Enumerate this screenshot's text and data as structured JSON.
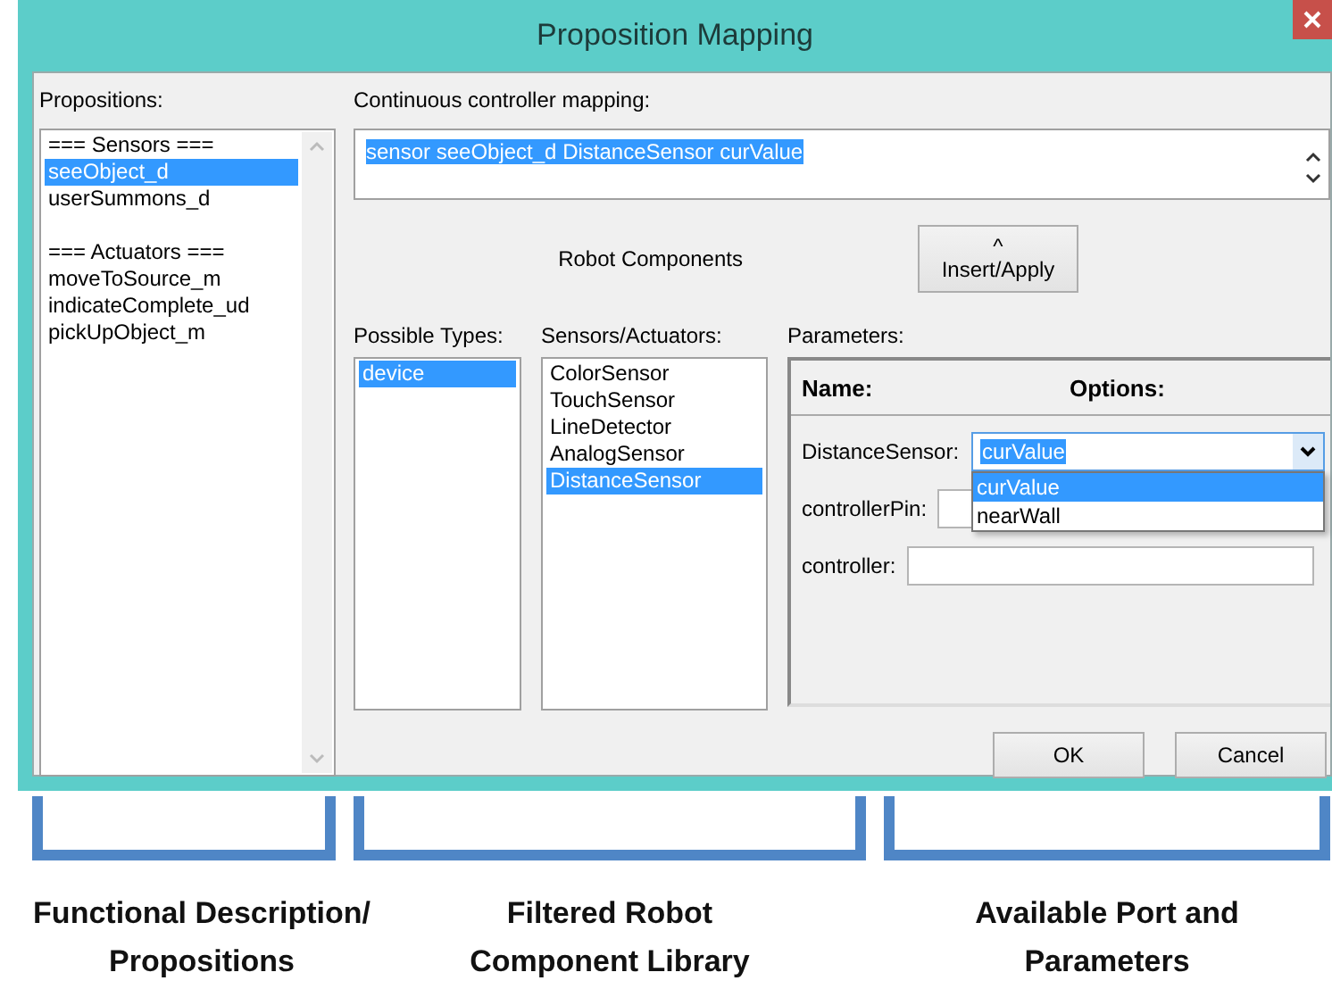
{
  "window": {
    "title": "Proposition Mapping"
  },
  "propositions": {
    "label": "Propositions:",
    "items": [
      {
        "text": "=== Sensors ===",
        "kind": "header",
        "selected": false
      },
      {
        "text": "seeObject_d",
        "kind": "item",
        "selected": true
      },
      {
        "text": "userSummons_d",
        "kind": "item",
        "selected": false
      },
      {
        "text": "=== Actuators ===",
        "kind": "header",
        "selected": false
      },
      {
        "text": "moveToSource_m",
        "kind": "item",
        "selected": false
      },
      {
        "text": "indicateComplete_ud",
        "kind": "item",
        "selected": false
      },
      {
        "text": "pickUpObject_m",
        "kind": "item",
        "selected": false
      }
    ]
  },
  "mapping": {
    "label": "Continuous controller mapping:",
    "value": "sensor seeObject_d DistanceSensor curValue",
    "selected": true
  },
  "robot_components": {
    "title": "Robot Components"
  },
  "insert_button": {
    "arrow": "^",
    "label": "Insert/Apply"
  },
  "possible_types": {
    "label": "Possible Types:",
    "items": [
      {
        "text": "device",
        "selected": true
      }
    ]
  },
  "sensors_actuators": {
    "label": "Sensors/Actuators:",
    "items": [
      {
        "text": "ColorSensor",
        "selected": false
      },
      {
        "text": "TouchSensor",
        "selected": false
      },
      {
        "text": "LineDetector",
        "selected": false
      },
      {
        "text": "AnalogSensor",
        "selected": false
      },
      {
        "text": "DistanceSensor",
        "selected": true
      }
    ]
  },
  "parameters": {
    "label": "Parameters:",
    "columns": [
      "Name:",
      "Options:"
    ],
    "rows": [
      {
        "name": "DistanceSensor:",
        "kind": "combo",
        "value": "curValue",
        "expanded": true,
        "options": [
          {
            "text": "curValue",
            "selected": true
          },
          {
            "text": "nearWall",
            "selected": false
          }
        ]
      },
      {
        "name": "controllerPin:",
        "kind": "text"
      },
      {
        "name": "controller:",
        "kind": "text"
      }
    ]
  },
  "buttons": [
    "OK",
    "Cancel"
  ],
  "annotations": [
    {
      "label": "Functional Description/\nPropositions"
    },
    {
      "label": "Filtered Robot\nComponent Library"
    },
    {
      "label": "Available Port and\nParameters"
    }
  ]
}
